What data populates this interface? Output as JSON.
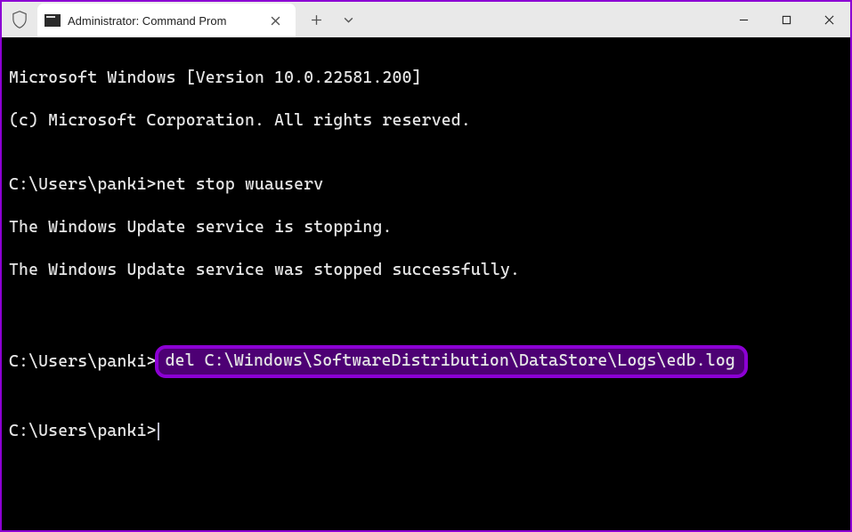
{
  "titlebar": {
    "tab_title": "Administrator: Command Prom",
    "tab_icon_name": "cmd-icon"
  },
  "terminal": {
    "line1": "Microsoft Windows [Version 10.0.22581.200]",
    "line2": "(c) Microsoft Corporation. All rights reserved.",
    "blank1": "",
    "line3_prompt": "C:\\Users\\panki>",
    "line3_cmd": "net stop wuauserv",
    "line4": "The Windows Update service is stopping.",
    "line5": "The Windows Update service was stopped successfully.",
    "blank2": "",
    "blank3": "",
    "line6_prompt": "C:\\Users\\panki>",
    "line6_cmd_highlighted": "del C:\\Windows\\SoftwareDistribution\\DataStore\\Logs\\edb.log",
    "blank4": "",
    "line7_prompt": "C:\\Users\\panki>"
  },
  "colors": {
    "accent": "#8c00d4",
    "titlebar_bg": "#e9e9e9",
    "tab_bg": "#ffffff",
    "terminal_bg": "#000000",
    "terminal_fg": "#e6e6e6"
  }
}
